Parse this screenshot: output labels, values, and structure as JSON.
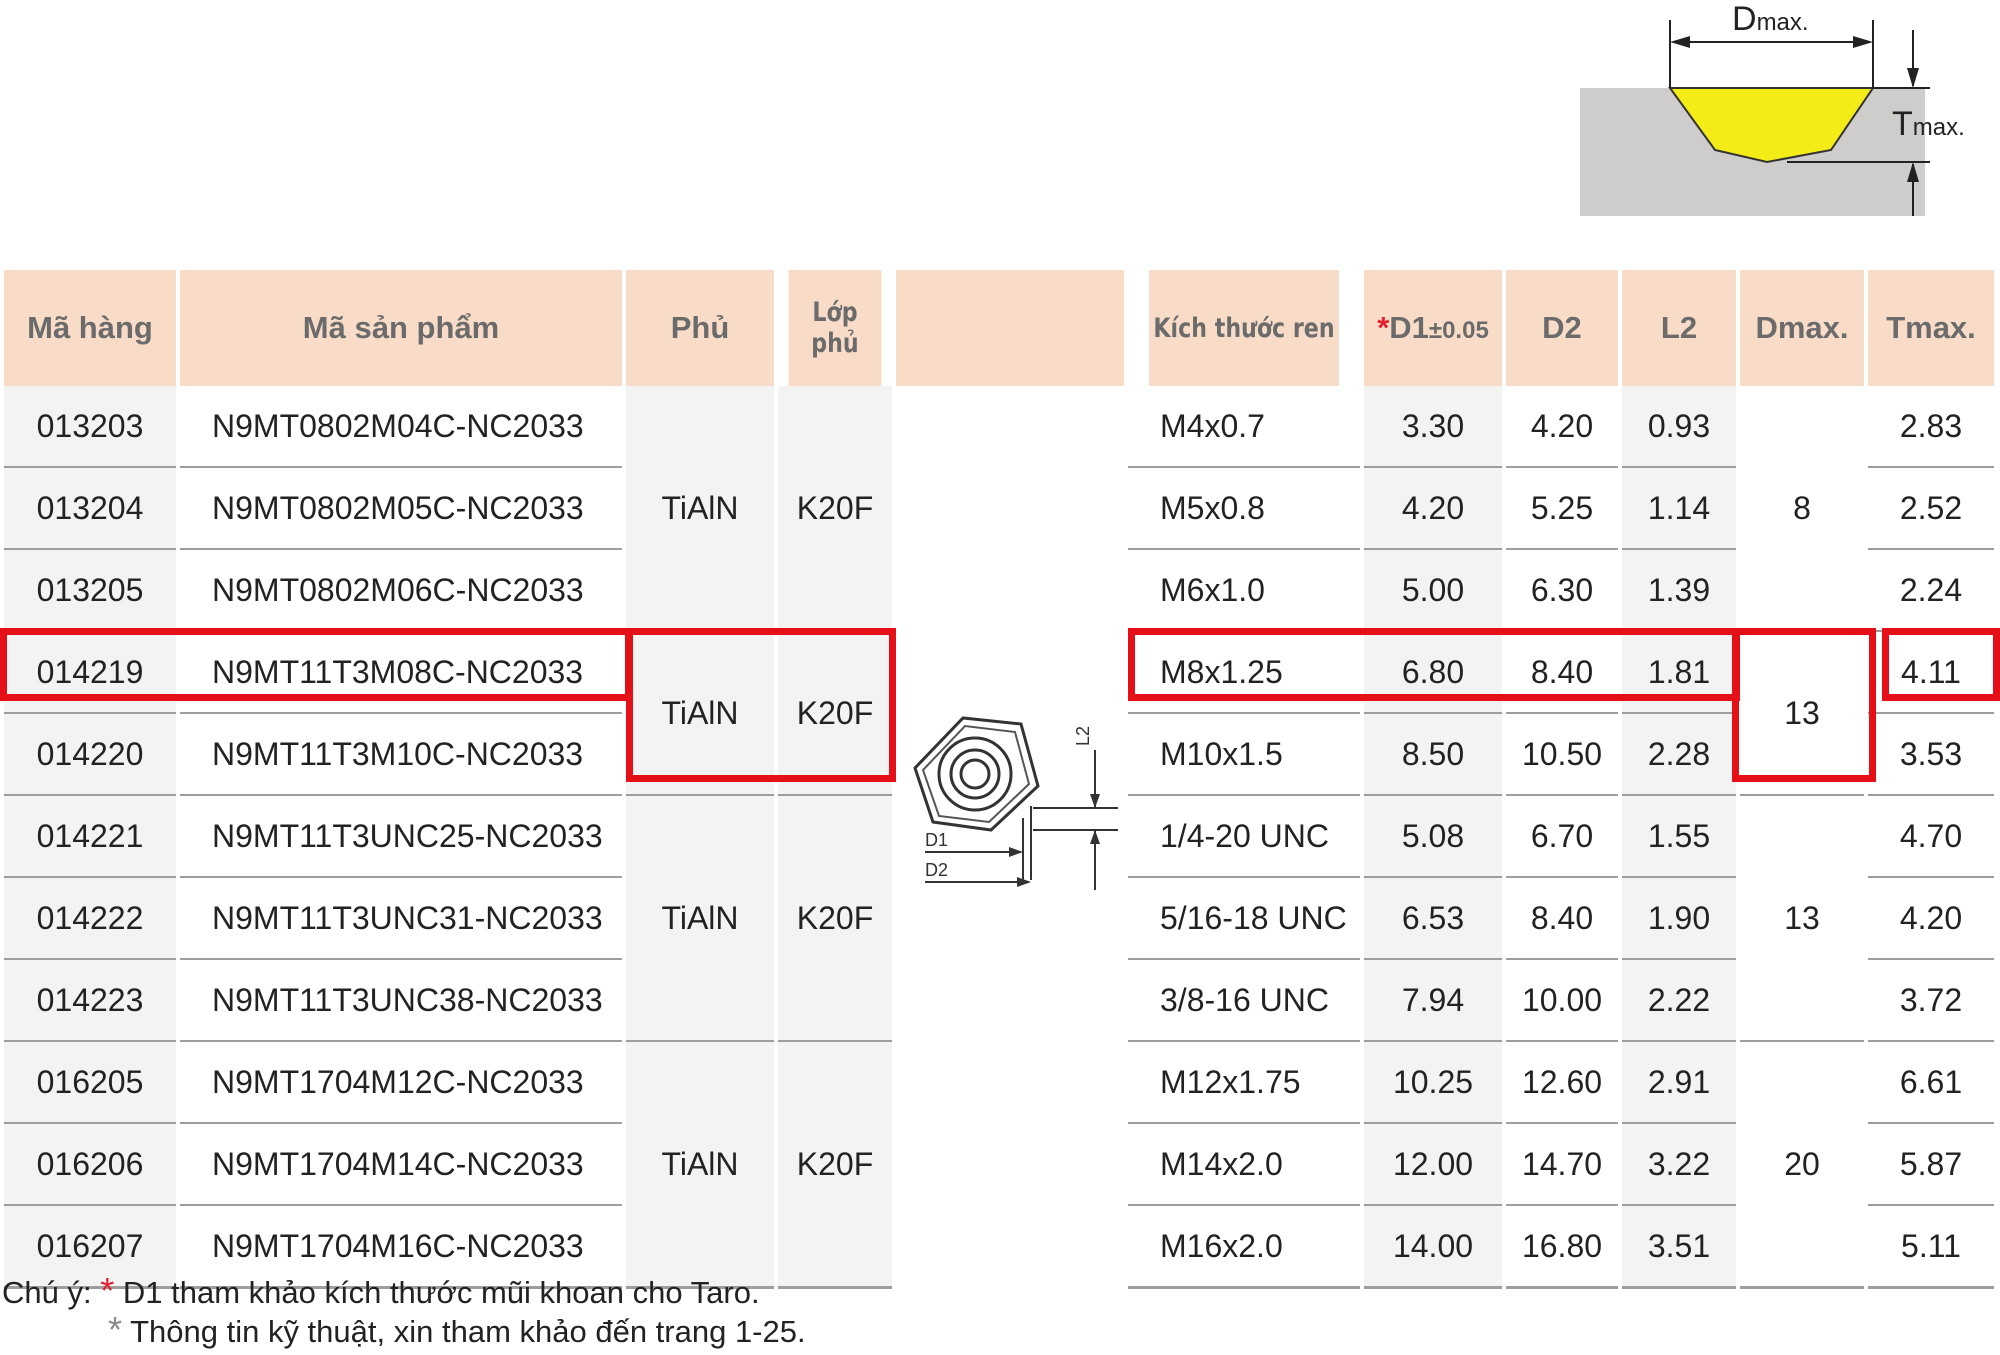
{
  "diagram": {
    "d_label_big": "D",
    "d_label_small": "max.",
    "t_label_big": "T",
    "t_label_small": "max.",
    "colors": {
      "insert": "#f4ec17",
      "workpiece": "#cfcccc"
    }
  },
  "insert_labels": {
    "l2": "L2",
    "d1": "D1",
    "d2": "D2"
  },
  "headers": {
    "ma_hang": "Mã hàng",
    "ma_san_pham": "Mã sản phẩm",
    "phu": "Phủ",
    "lop_phu": "Lớp phủ",
    "kich_thuoc_ren": "Kích thước ren",
    "d1_star": "*",
    "d1": "D1",
    "d1_tol": "±0.05",
    "d2": "D2",
    "l2": "L2",
    "dmax": "Dmax.",
    "tmax": "Tmax."
  },
  "rows": [
    {
      "code": "013203",
      "product": "N9MT0802M04C-NC2033",
      "thread": "M4x0.7",
      "d1": "3.30",
      "d2": "4.20",
      "l2": "0.93",
      "tmax": "2.83"
    },
    {
      "code": "013204",
      "product": "N9MT0802M05C-NC2033",
      "thread": "M5x0.8",
      "d1": "4.20",
      "d2": "5.25",
      "l2": "1.14",
      "tmax": "2.52"
    },
    {
      "code": "013205",
      "product": "N9MT0802M06C-NC2033",
      "thread": "M6x1.0",
      "d1": "5.00",
      "d2": "6.30",
      "l2": "1.39",
      "tmax": "2.24"
    },
    {
      "code": "014219",
      "product": "N9MT11T3M08C-NC2033",
      "thread": "M8x1.25",
      "d1": "6.80",
      "d2": "8.40",
      "l2": "1.81",
      "tmax": "4.11"
    },
    {
      "code": "014220",
      "product": "N9MT11T3M10C-NC2033",
      "thread": "M10x1.5",
      "d1": "8.50",
      "d2": "10.50",
      "l2": "2.28",
      "tmax": "3.53"
    },
    {
      "code": "014221",
      "product": "N9MT11T3UNC25-NC2033",
      "thread": "1/4-20 UNC",
      "d1": "5.08",
      "d2": "6.70",
      "l2": "1.55",
      "tmax": "4.70"
    },
    {
      "code": "014222",
      "product": "N9MT11T3UNC31-NC2033",
      "thread": "5/16-18 UNC",
      "d1": "6.53",
      "d2": "8.40",
      "l2": "1.90",
      "tmax": "4.20"
    },
    {
      "code": "014223",
      "product": "N9MT11T3UNC38-NC2033",
      "thread": "3/8-16 UNC",
      "d1": "7.94",
      "d2": "10.00",
      "l2": "2.22",
      "tmax": "3.72"
    },
    {
      "code": "016205",
      "product": "N9MT1704M12C-NC2033",
      "thread": "M12x1.75",
      "d1": "10.25",
      "d2": "12.60",
      "l2": "2.91",
      "tmax": "6.61"
    },
    {
      "code": "016206",
      "product": "N9MT1704M14C-NC2033",
      "thread": "M14x2.0",
      "d1": "12.00",
      "d2": "14.70",
      "l2": "3.22",
      "tmax": "5.87"
    },
    {
      "code": "016207",
      "product": "N9MT1704M16C-NC2033",
      "thread": "M16x2.0",
      "d1": "14.00",
      "d2": "16.80",
      "l2": "3.51",
      "tmax": "5.11"
    }
  ],
  "groups": [
    {
      "coating": "TiAlN",
      "grade": "K20F",
      "dmax": "8"
    },
    {
      "coating": "TiAlN",
      "grade": "K20F",
      "dmax": "13"
    },
    {
      "coating": "TiAlN",
      "grade": "K20F",
      "dmax": "13"
    },
    {
      "coating": "TiAlN",
      "grade": "K20F",
      "dmax": "20"
    }
  ],
  "notes": {
    "prefix": "Chú ý:",
    "line1": "D1 tham khảo kích thước mũi khoan cho Taro.",
    "line2": "Thông tin kỹ thuật, xin tham khảo đến trang 1-25.",
    "star": "*"
  },
  "highlight_color": "#e50f18"
}
